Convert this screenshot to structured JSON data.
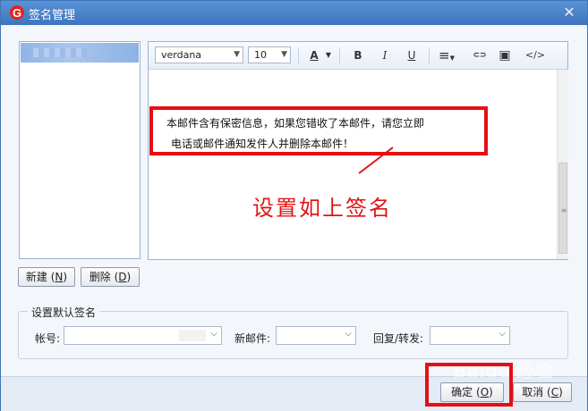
{
  "window": {
    "title": "签名管理",
    "close_glyph": "✕",
    "logo_icon": "app-logo-icon"
  },
  "toolbar": {
    "font_family": "verdana",
    "font_size": "10",
    "font_color_glyph": "A",
    "bold_glyph": "B",
    "italic_glyph": "I",
    "underline_glyph": "U",
    "align_glyph": "≡",
    "link_glyph": "⊂⊃",
    "image_glyph": "▣",
    "source_glyph": "</>"
  },
  "editor": {
    "signature_line1": "本邮件含有保密信息，如果您错收了本邮件，请您立即",
    "signature_line2": "电话或邮件通知发件人并删除本邮件！",
    "annotation": "设置如上签名"
  },
  "list_buttons": {
    "new_label": "新建",
    "new_key": "N",
    "delete_label": "删除",
    "delete_key": "D"
  },
  "defaults": {
    "group_title": "设置默认签名",
    "account_label": "帐号:",
    "new_mail_label": "新邮件:",
    "reply_label": "回复/转发:"
  },
  "footer": {
    "ok_label": "确定",
    "ok_key": "O",
    "cancel_label": "取消",
    "cancel_key": "C"
  },
  "colors": {
    "title_bar": "#4a83cc",
    "highlight_red": "#e60f14"
  }
}
